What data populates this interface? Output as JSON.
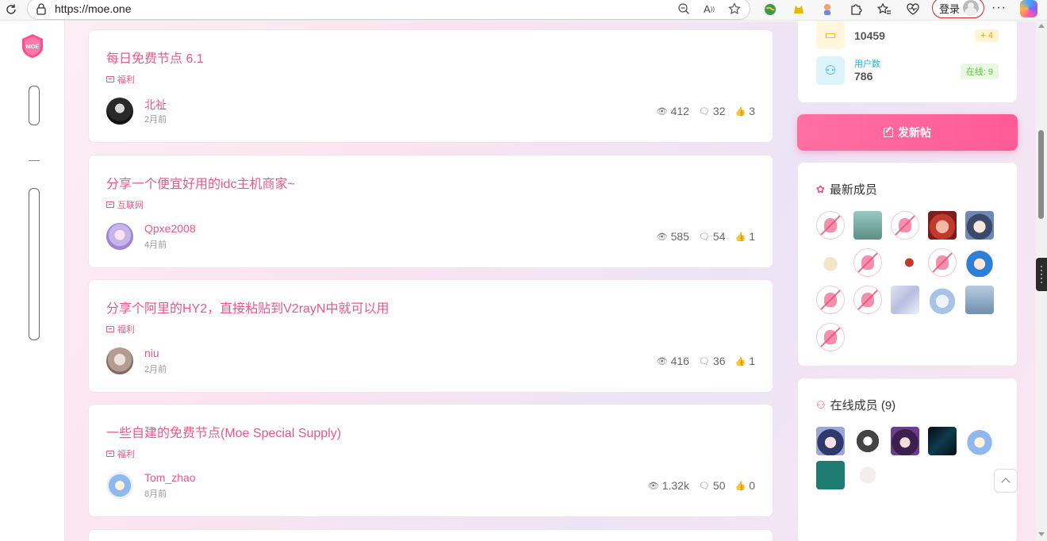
{
  "browser": {
    "url": "https://moe.one",
    "login_label": "登录",
    "more_label": "···"
  },
  "site": {
    "logo_text": "MOE"
  },
  "posts": [
    {
      "title": "每日免费节点 6.1",
      "category": "福利",
      "author": "北祉",
      "time": "2月前",
      "views": "412",
      "comments": "32",
      "likes": "3"
    },
    {
      "title": "分享一个便宜好用的idc主机商家~",
      "category": "互联网",
      "author": "Qpxe2008",
      "time": "4月前",
      "views": "585",
      "comments": "54",
      "likes": "1"
    },
    {
      "title": "分享个阿里的HY2，直接粘贴到V2rayN中就可以用",
      "category": "福利",
      "author": "niu",
      "time": "2月前",
      "views": "416",
      "comments": "36",
      "likes": "1"
    },
    {
      "title": "一些自建的免费节点(Moe Special Supply)",
      "category": "福利",
      "author": "Tom_zhao",
      "time": "8月前",
      "views": "1.32k",
      "comments": "50",
      "likes": "0"
    }
  ],
  "site_stats": {
    "replies_value": "10459",
    "replies_badge": "+ 4",
    "users_label": "用户数",
    "users_value": "786",
    "online_badge": "在线: 9"
  },
  "new_post_label": "发新帖",
  "latest_members": {
    "title": "最新成员",
    "count": 16
  },
  "online_members": {
    "title": "在线成员 (9)",
    "count": 7
  }
}
